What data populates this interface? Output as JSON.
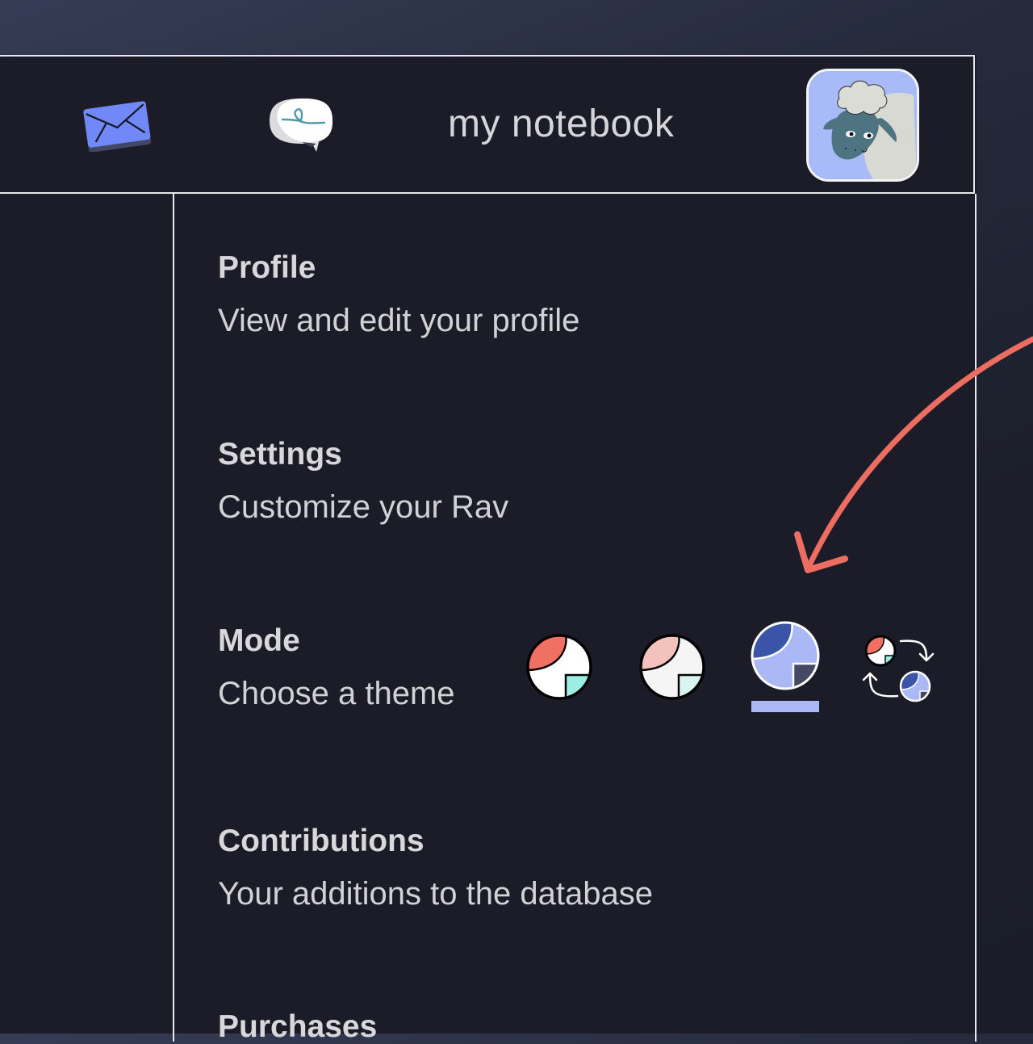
{
  "header": {
    "notebook_title": "my notebook",
    "icons": {
      "mail": "mail-icon",
      "chat": "chat-bubble-icon",
      "avatar": "sheep-avatar"
    }
  },
  "menu": {
    "items": [
      {
        "title": "Profile",
        "description": "View and edit your profile"
      },
      {
        "title": "Settings",
        "description": "Customize your Rav"
      },
      {
        "title": "Mode",
        "description": "Choose a theme"
      },
      {
        "title": "Contributions",
        "description": "Your additions to the database"
      },
      {
        "title": "Purchases",
        "description": ""
      }
    ]
  },
  "themes": {
    "options": [
      {
        "name": "light-coral",
        "selected": false
      },
      {
        "name": "light-pastel",
        "selected": false
      },
      {
        "name": "dark-blue",
        "selected": true
      },
      {
        "name": "auto-switch",
        "selected": false
      }
    ],
    "colors": {
      "coral": "#f07064",
      "pastel_pink": "#f4c2bd",
      "mint": "#9aeee2",
      "pale_mint": "#daf4f0",
      "royal_blue": "#3a55a8",
      "periwinkle": "#aab9f5",
      "slate": "#434863"
    }
  },
  "annotation": {
    "arrow_color": "#ee6d61"
  }
}
